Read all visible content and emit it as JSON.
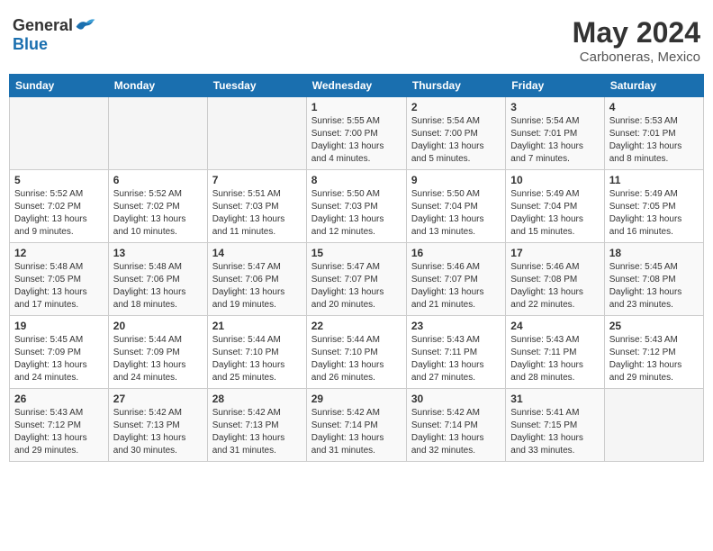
{
  "header": {
    "logo_general": "General",
    "logo_blue": "Blue",
    "month": "May 2024",
    "location": "Carboneras, Mexico"
  },
  "weekdays": [
    "Sunday",
    "Monday",
    "Tuesday",
    "Wednesday",
    "Thursday",
    "Friday",
    "Saturday"
  ],
  "weeks": [
    [
      {
        "day": "",
        "info": ""
      },
      {
        "day": "",
        "info": ""
      },
      {
        "day": "",
        "info": ""
      },
      {
        "day": "1",
        "info": "Sunrise: 5:55 AM\nSunset: 7:00 PM\nDaylight: 13 hours\nand 4 minutes."
      },
      {
        "day": "2",
        "info": "Sunrise: 5:54 AM\nSunset: 7:00 PM\nDaylight: 13 hours\nand 5 minutes."
      },
      {
        "day": "3",
        "info": "Sunrise: 5:54 AM\nSunset: 7:01 PM\nDaylight: 13 hours\nand 7 minutes."
      },
      {
        "day": "4",
        "info": "Sunrise: 5:53 AM\nSunset: 7:01 PM\nDaylight: 13 hours\nand 8 minutes."
      }
    ],
    [
      {
        "day": "5",
        "info": "Sunrise: 5:52 AM\nSunset: 7:02 PM\nDaylight: 13 hours\nand 9 minutes."
      },
      {
        "day": "6",
        "info": "Sunrise: 5:52 AM\nSunset: 7:02 PM\nDaylight: 13 hours\nand 10 minutes."
      },
      {
        "day": "7",
        "info": "Sunrise: 5:51 AM\nSunset: 7:03 PM\nDaylight: 13 hours\nand 11 minutes."
      },
      {
        "day": "8",
        "info": "Sunrise: 5:50 AM\nSunset: 7:03 PM\nDaylight: 13 hours\nand 12 minutes."
      },
      {
        "day": "9",
        "info": "Sunrise: 5:50 AM\nSunset: 7:04 PM\nDaylight: 13 hours\nand 13 minutes."
      },
      {
        "day": "10",
        "info": "Sunrise: 5:49 AM\nSunset: 7:04 PM\nDaylight: 13 hours\nand 15 minutes."
      },
      {
        "day": "11",
        "info": "Sunrise: 5:49 AM\nSunset: 7:05 PM\nDaylight: 13 hours\nand 16 minutes."
      }
    ],
    [
      {
        "day": "12",
        "info": "Sunrise: 5:48 AM\nSunset: 7:05 PM\nDaylight: 13 hours\nand 17 minutes."
      },
      {
        "day": "13",
        "info": "Sunrise: 5:48 AM\nSunset: 7:06 PM\nDaylight: 13 hours\nand 18 minutes."
      },
      {
        "day": "14",
        "info": "Sunrise: 5:47 AM\nSunset: 7:06 PM\nDaylight: 13 hours\nand 19 minutes."
      },
      {
        "day": "15",
        "info": "Sunrise: 5:47 AM\nSunset: 7:07 PM\nDaylight: 13 hours\nand 20 minutes."
      },
      {
        "day": "16",
        "info": "Sunrise: 5:46 AM\nSunset: 7:07 PM\nDaylight: 13 hours\nand 21 minutes."
      },
      {
        "day": "17",
        "info": "Sunrise: 5:46 AM\nSunset: 7:08 PM\nDaylight: 13 hours\nand 22 minutes."
      },
      {
        "day": "18",
        "info": "Sunrise: 5:45 AM\nSunset: 7:08 PM\nDaylight: 13 hours\nand 23 minutes."
      }
    ],
    [
      {
        "day": "19",
        "info": "Sunrise: 5:45 AM\nSunset: 7:09 PM\nDaylight: 13 hours\nand 24 minutes."
      },
      {
        "day": "20",
        "info": "Sunrise: 5:44 AM\nSunset: 7:09 PM\nDaylight: 13 hours\nand 24 minutes."
      },
      {
        "day": "21",
        "info": "Sunrise: 5:44 AM\nSunset: 7:10 PM\nDaylight: 13 hours\nand 25 minutes."
      },
      {
        "day": "22",
        "info": "Sunrise: 5:44 AM\nSunset: 7:10 PM\nDaylight: 13 hours\nand 26 minutes."
      },
      {
        "day": "23",
        "info": "Sunrise: 5:43 AM\nSunset: 7:11 PM\nDaylight: 13 hours\nand 27 minutes."
      },
      {
        "day": "24",
        "info": "Sunrise: 5:43 AM\nSunset: 7:11 PM\nDaylight: 13 hours\nand 28 minutes."
      },
      {
        "day": "25",
        "info": "Sunrise: 5:43 AM\nSunset: 7:12 PM\nDaylight: 13 hours\nand 29 minutes."
      }
    ],
    [
      {
        "day": "26",
        "info": "Sunrise: 5:43 AM\nSunset: 7:12 PM\nDaylight: 13 hours\nand 29 minutes."
      },
      {
        "day": "27",
        "info": "Sunrise: 5:42 AM\nSunset: 7:13 PM\nDaylight: 13 hours\nand 30 minutes."
      },
      {
        "day": "28",
        "info": "Sunrise: 5:42 AM\nSunset: 7:13 PM\nDaylight: 13 hours\nand 31 minutes."
      },
      {
        "day": "29",
        "info": "Sunrise: 5:42 AM\nSunset: 7:14 PM\nDaylight: 13 hours\nand 31 minutes."
      },
      {
        "day": "30",
        "info": "Sunrise: 5:42 AM\nSunset: 7:14 PM\nDaylight: 13 hours\nand 32 minutes."
      },
      {
        "day": "31",
        "info": "Sunrise: 5:41 AM\nSunset: 7:15 PM\nDaylight: 13 hours\nand 33 minutes."
      },
      {
        "day": "",
        "info": ""
      }
    ]
  ]
}
